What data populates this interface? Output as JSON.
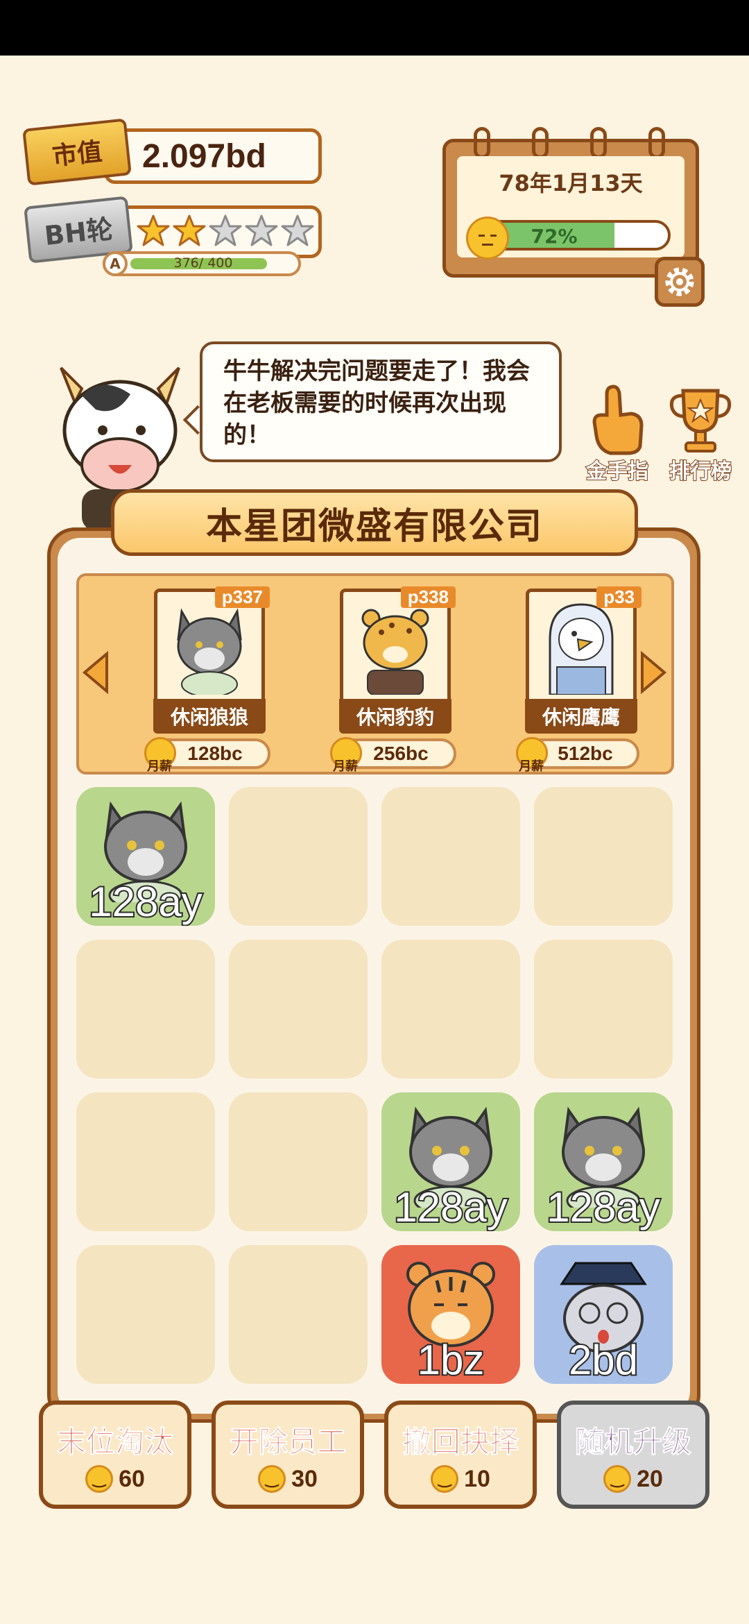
{
  "header": {
    "market_value_badge": "市值",
    "market_value": "2.097bd",
    "round_badge": "BH轮",
    "stars_filled": 2,
    "stars_total": 5,
    "level_letter": "A",
    "progress_text": "376/ 400",
    "progress_fraction": 0.94
  },
  "calendar": {
    "date": "78年1月13天",
    "mood_percent_text": "72%",
    "mood_fraction": 0.72
  },
  "dialog": {
    "text": "牛牛解决完问题要走了！我会在老板需要的时候再次出现的！"
  },
  "side_buttons": {
    "golden_finger": "金手指",
    "leaderboard": "排行榜"
  },
  "company": {
    "name": "本星团微盛有限公司"
  },
  "shop": {
    "monthly_label": "月薪",
    "cards": [
      {
        "tag": "p337",
        "name": "休闲狼狼",
        "price": "128bc"
      },
      {
        "tag": "p338",
        "name": "休闲豹豹",
        "price": "256bc"
      },
      {
        "tag": "p33",
        "name": "休闲鹰鹰",
        "price": "512bc"
      }
    ]
  },
  "grid": {
    "cells": [
      {
        "value": "128ay",
        "kind": "wolf"
      },
      {
        "value": "",
        "kind": "empty"
      },
      {
        "value": "",
        "kind": "empty"
      },
      {
        "value": "",
        "kind": "empty"
      },
      {
        "value": "",
        "kind": "empty"
      },
      {
        "value": "",
        "kind": "empty"
      },
      {
        "value": "",
        "kind": "empty"
      },
      {
        "value": "",
        "kind": "empty"
      },
      {
        "value": "",
        "kind": "empty"
      },
      {
        "value": "",
        "kind": "empty"
      },
      {
        "value": "128ay",
        "kind": "wolf"
      },
      {
        "value": "128ay",
        "kind": "wolf"
      },
      {
        "value": "",
        "kind": "empty"
      },
      {
        "value": "",
        "kind": "empty"
      },
      {
        "value": "1bz",
        "kind": "tiger"
      },
      {
        "value": "2bd",
        "kind": "mouse"
      }
    ]
  },
  "actions": [
    {
      "label": "末位淘汰",
      "cost": "60"
    },
    {
      "label": "开除员工",
      "cost": "30"
    },
    {
      "label": "撤回抉择",
      "cost": "10"
    },
    {
      "label": "随机升级",
      "cost": "20"
    }
  ],
  "colors": {
    "background": "#fcf3e0",
    "brown": "#8a4a17",
    "progress_green": "#8dc454",
    "wolf_cell": "#b8d68c",
    "tiger_cell": "#e8664a",
    "mouse_cell": "#a8bfe8"
  }
}
